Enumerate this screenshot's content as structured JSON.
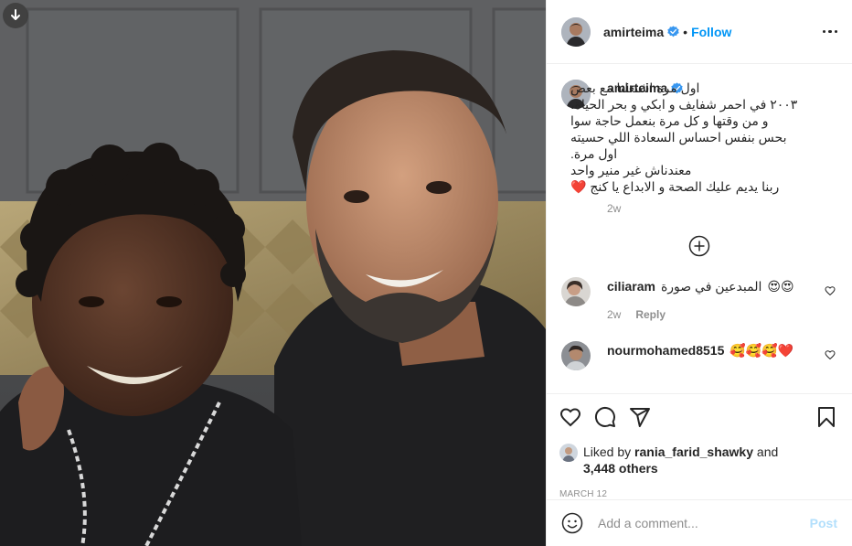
{
  "post": {
    "username": "amirteima",
    "follow_label": "Follow",
    "separator": "•",
    "photo_alt": "photo",
    "caption_user": "amirteima",
    "caption_lines": [
      "اول مرة اشتغلنا مع بعض",
      "٢٠٠٣ في احمر شفايف و ابكي و بحر الحياة،",
      "و من وقتها و كل مرة بنعمل حاجة سوا",
      "بحس بنفس احساس السعادة اللي حسيته",
      "اول مرة.",
      "معندناش غير منير واحد",
      "ربنا يديم عليك الصحة و الابداع يا كنج"
    ],
    "caption_time": "2w",
    "caption_heart": "❤️"
  },
  "comments": [
    {
      "user": "ciliaram",
      "text": "المبدعين في صورة",
      "emojis": "😍😍",
      "time": "2w",
      "reply": "Reply"
    },
    {
      "user": "nourmohamed8515",
      "text": "",
      "emojis": "🥰🥰🥰❤️",
      "time": "",
      "reply": ""
    }
  ],
  "likes": {
    "prefix": "Liked by",
    "user": "rania_farid_shawky",
    "and": "and",
    "others": "3,448 others"
  },
  "date": "MARCH 12",
  "add_comment": {
    "placeholder": "Add a comment...",
    "post_label": "Post"
  },
  "icons": [
    "download-icon",
    "verified-icon",
    "more-icon",
    "add-circle-icon",
    "heart-icon",
    "comment-icon",
    "share-icon",
    "save-icon",
    "emoji-icon"
  ],
  "colors": {
    "follow": "#0095f6",
    "post_disabled": "#b2dffc",
    "muted": "#8e8e8e",
    "text": "#262626"
  }
}
